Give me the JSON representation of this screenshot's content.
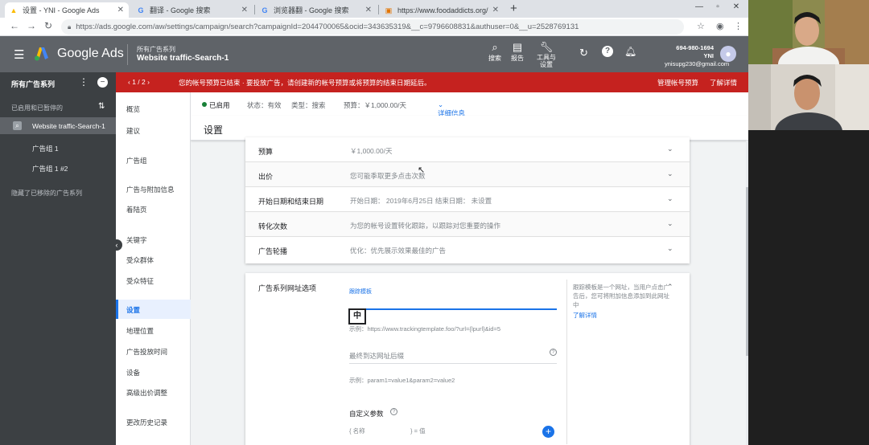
{
  "browser": {
    "tabs": [
      {
        "title": "设置 - YNI - Google Ads",
        "icon": "google-ads-icon",
        "active": true
      },
      {
        "title": "翻译 - Google 搜索",
        "icon": "google-g-icon",
        "active": false
      },
      {
        "title": "浏览器翻 - Google 搜索",
        "icon": "google-g-icon",
        "active": false
      },
      {
        "title": "https://www.foodaddicts.org/",
        "icon": "page-icon",
        "active": false
      }
    ],
    "url": "https://ads.google.com/aw/settings/campaign/search?campaignId=2044700065&ocid=343635319&__c=9796608831&authuser=0&__u=2528769131"
  },
  "header": {
    "app_name": "Google Ads",
    "breadcrumb": "所有广告系列",
    "campaign_name": "Website traffic-Search-1",
    "actions": [
      {
        "label": "搜索",
        "icon": "search-icon"
      },
      {
        "label": "报告",
        "icon": "report-icon"
      },
      {
        "label": "工具与设置",
        "icon": "wrench-icon"
      }
    ],
    "account_id": "694-980-1694 YNI",
    "account_email": "ynisupg230@gmail.com"
  },
  "alert": {
    "pager": "1 / 2",
    "message": "您的帐号预算已结束 · 要投放广告，请创建新的帐号预算或将预算的结束日期延后。",
    "action1": "管理帐号预算",
    "action2": "了解详情"
  },
  "left_nav": {
    "title": "所有广告系列",
    "filter": "已启用和已暂停的",
    "selected_campaign": "Website traffic-Search-1",
    "ad_groups": [
      "广告组 1",
      "广告组 1 #2"
    ],
    "removed": "隐藏了已移除的广告系列"
  },
  "page_nav": [
    {
      "label": "概览",
      "active": false
    },
    {
      "label": "建议",
      "active": false
    },
    {
      "label": "广告组",
      "active": false
    },
    {
      "label": "广告与附加信息",
      "active": false
    },
    {
      "label": "着陆页",
      "active": false
    },
    {
      "label": "关键字",
      "active": false
    },
    {
      "label": "受众群体",
      "active": false
    },
    {
      "label": "受众特征",
      "active": false
    },
    {
      "label": "设置",
      "active": true
    },
    {
      "label": "地理位置",
      "active": false
    },
    {
      "label": "广告投放时间",
      "active": false
    },
    {
      "label": "设备",
      "active": false
    },
    {
      "label": "高级出价调整",
      "active": false
    },
    {
      "label": "更改历史记录",
      "active": false
    }
  ],
  "status_row": {
    "status": "已启用",
    "state": "状态：有效",
    "type": "类型：搜索",
    "budget": "预算：￥1,000.00/天",
    "details": "详细信息"
  },
  "page_title": "设置",
  "settings": [
    {
      "label": "预算",
      "value": "￥1,000.00/天"
    },
    {
      "label": "出价",
      "value": "您可能季取更多点击次数"
    },
    {
      "label": "开始日期和结束日期",
      "value": "开始日期： 2019年6月25日     结束日期： 未设置"
    },
    {
      "label": "转化次数",
      "value": "为您的帐号设置转化跟踪，以跟踪对您重要的操作"
    },
    {
      "label": "广告轮播",
      "value": "优化：优先展示效果最佳的广告"
    }
  ],
  "url_options": {
    "title": "广告系列网址选项",
    "tracking_label": "跟踪模板",
    "ime_char": "中",
    "example1": "示例：https://www.trackingtemplate.foo/?url={lpurl}&id=5",
    "final_url_suffix": "最终到达网址后缀",
    "example2": "示例：param1=value1&param2=value2",
    "custom_params": "自定义参数",
    "name_placeholder": "名称",
    "value_placeholder": "值",
    "help": "跟踪模板是一个网址，当用户点击广告后，您可将附加信息添加到此网址中",
    "learn_more": "了解详情"
  }
}
